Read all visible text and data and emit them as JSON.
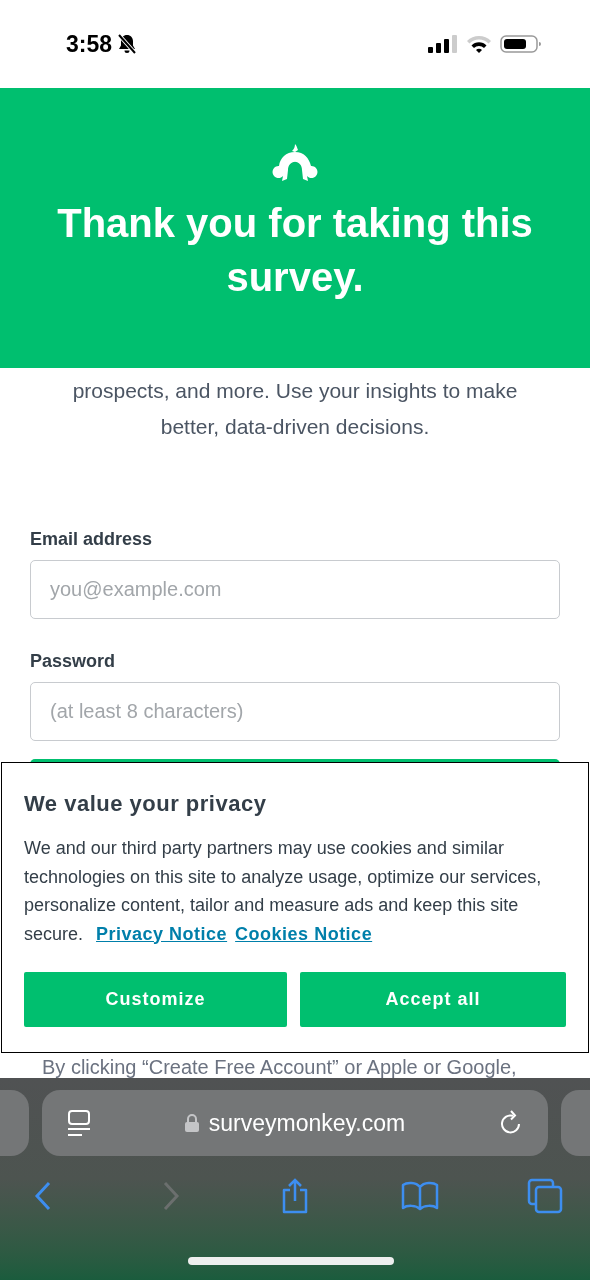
{
  "status_bar": {
    "time": "3:58"
  },
  "header": {
    "title": "Thank you for taking this survey."
  },
  "intro": "prospects, and more. Use your insights to make better, data-driven decisions.",
  "fields": [
    {
      "label": "Email address",
      "placeholder": "you@example.com"
    },
    {
      "label": "Password",
      "placeholder": "(at least 8 characters)"
    }
  ],
  "legal_text": "By clicking “Create Free Account” or Apple or Google,",
  "privacy_banner": {
    "title": "We value your privacy",
    "body": "We and our third party partners may use cookies and similar technologies on this site to analyze usage, optimize our services, personalize content, tailor and measure ads and keep this site secure.",
    "links": [
      "Privacy Notice",
      "Cookies Notice"
    ],
    "buttons": [
      "Customize",
      "Accept all"
    ]
  },
  "browser": {
    "url": "surveymonkey.com",
    "toolbar": [
      {
        "kind": "back",
        "disabled": false
      },
      {
        "kind": "forward",
        "disabled": true
      },
      {
        "kind": "share",
        "disabled": false
      },
      {
        "kind": "bookmarks",
        "disabled": false
      },
      {
        "kind": "tabs",
        "disabled": false
      }
    ]
  }
}
